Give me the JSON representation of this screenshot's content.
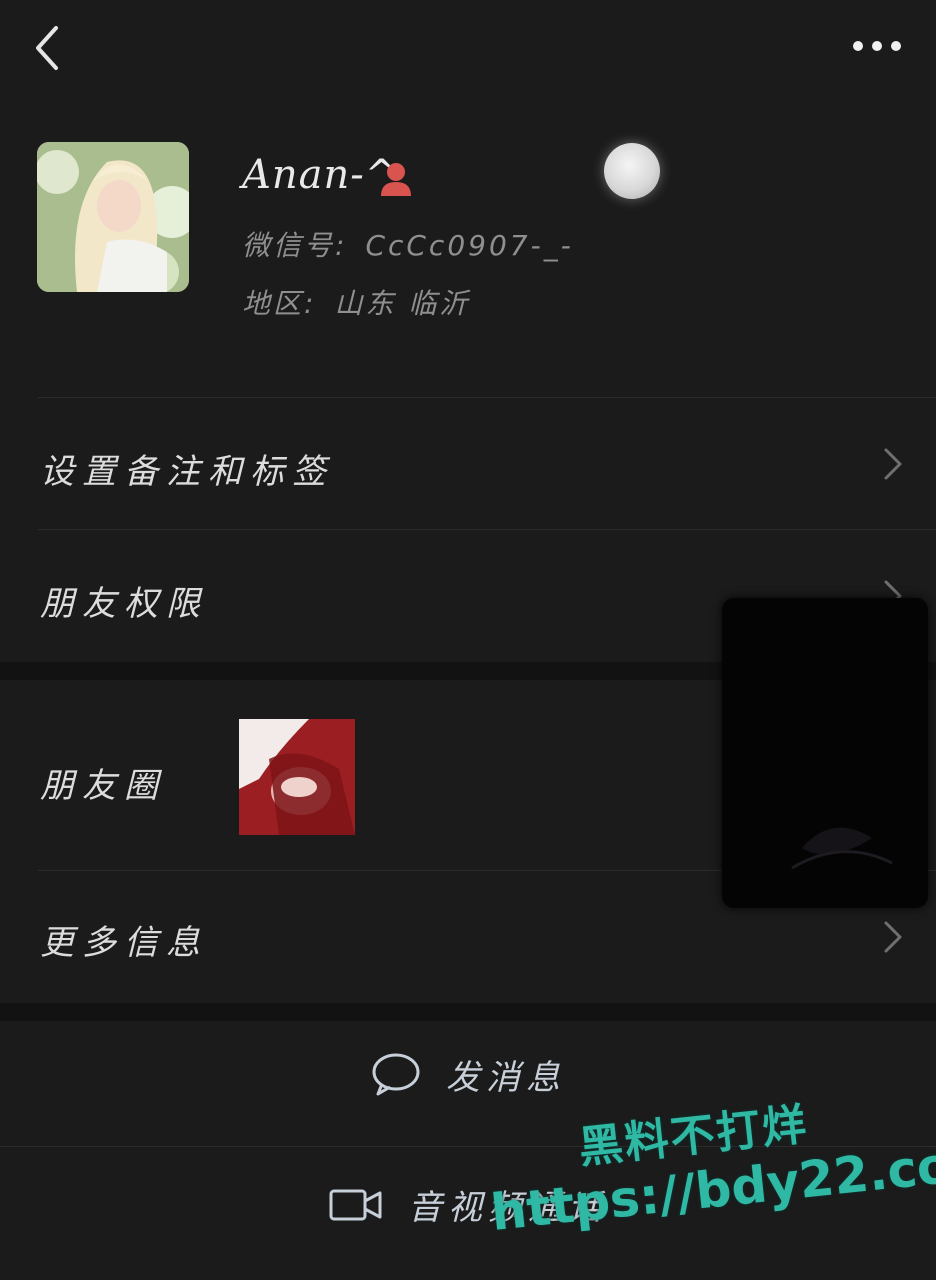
{
  "profile": {
    "nickname": "Anan-^",
    "wechat_id_label": "微信号:",
    "wechat_id": "CcCc0907-_-",
    "region_label": "地区:",
    "region": "山东  临沂"
  },
  "rows": {
    "remark_tags": "设置备注和标签",
    "friend_permissions": "朋友权限",
    "moments": "朋友圈",
    "more_info": "更多信息"
  },
  "actions": {
    "send_message": "发消息",
    "av_call": "音视频通话"
  },
  "watermark": {
    "line1": "黑料不打烊",
    "line2": "https://bdy22.co"
  },
  "colors": {
    "background": "#1b1b1b",
    "section_gap": "#121212",
    "text_primary": "#dcdcdc",
    "text_secondary": "#8f8f8f",
    "action_text": "#c7cfd9",
    "watermark": "#2fb8a3"
  },
  "icons": {
    "back": "chevron-left-icon",
    "more": "more-dots-icon",
    "chevron": "chevron-right-icon",
    "message": "chat-bubble-icon",
    "video": "video-camera-icon",
    "person": "person-icon"
  }
}
